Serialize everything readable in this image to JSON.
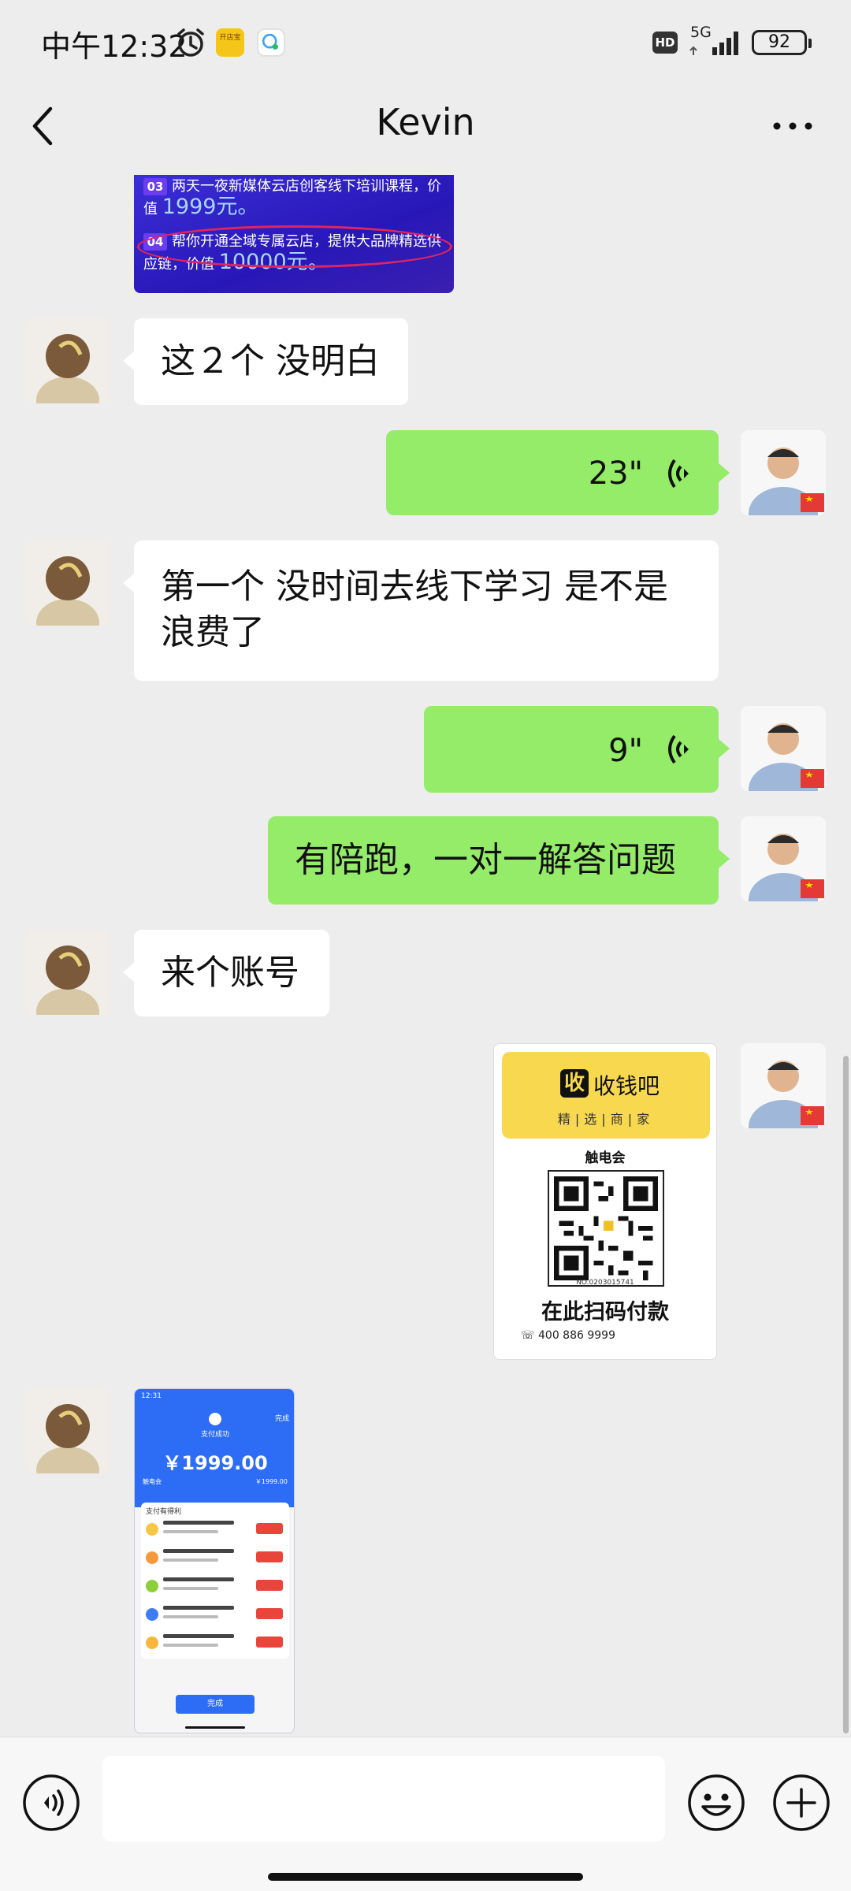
{
  "status_bar": {
    "time": "中午12:32",
    "network": "5G",
    "battery": "92",
    "hd_label": "HD",
    "app_badge_text": "开店宝"
  },
  "header": {
    "title": "Kevin"
  },
  "promo_image": {
    "row3_num": "03",
    "row3_text": "两天一夜新媒体云店创客线下培训课程，价值",
    "row3_price": "1999元。",
    "row4_num": "04",
    "row4_text": "帮你开通全域专属云店，提供大品牌精选供应链，价值",
    "row4_price": "10000元。"
  },
  "messages": [
    {
      "side": "left",
      "type": "text",
      "text": "这２个 没明白"
    },
    {
      "side": "right",
      "type": "voice",
      "duration": "23\""
    },
    {
      "side": "left",
      "type": "text",
      "text": "第一个 没时间去线下学习 是不是浪费了"
    },
    {
      "side": "right",
      "type": "voice",
      "duration": "9\""
    },
    {
      "side": "right",
      "type": "text",
      "text": "有陪跑，一对一解答问题"
    },
    {
      "side": "left",
      "type": "text",
      "text": "来个账号"
    },
    {
      "side": "right",
      "type": "image",
      "description": "qr-payment-card"
    },
    {
      "side": "left",
      "type": "image",
      "description": "payment-receipt-screenshot"
    }
  ],
  "qr_card": {
    "logo_char": "收",
    "brand": "收钱吧",
    "tagline": "精|选|商|家",
    "merchant": "触电会",
    "code_id": "NO.0203015741",
    "pay_text": "在此扫码付款",
    "phone": "400 886 9999"
  },
  "payment_shot": {
    "time": "12:31",
    "done_label": "完成",
    "status": "支付成功",
    "amount": "￥1999.00",
    "merchant": "触电会",
    "merchant_amount": "￥1999.00",
    "list_title": "支付有得利",
    "finish_button": "完成",
    "item_colors": [
      "#f6c744",
      "#f59a3a",
      "#8ccf3a",
      "#3d7cf5",
      "#f6b73c"
    ]
  },
  "input_bar": {
    "placeholder": ""
  },
  "colors": {
    "background": "#ededed",
    "bubble_green": "#95ec69",
    "bubble_white": "#ffffff",
    "accent_blue": "#2d6df6"
  },
  "icons": [
    "back-icon",
    "more-icon",
    "alarm-icon",
    "signal-icon",
    "voice-wave-icon",
    "voice-input-icon",
    "emoji-icon",
    "plus-icon"
  ]
}
